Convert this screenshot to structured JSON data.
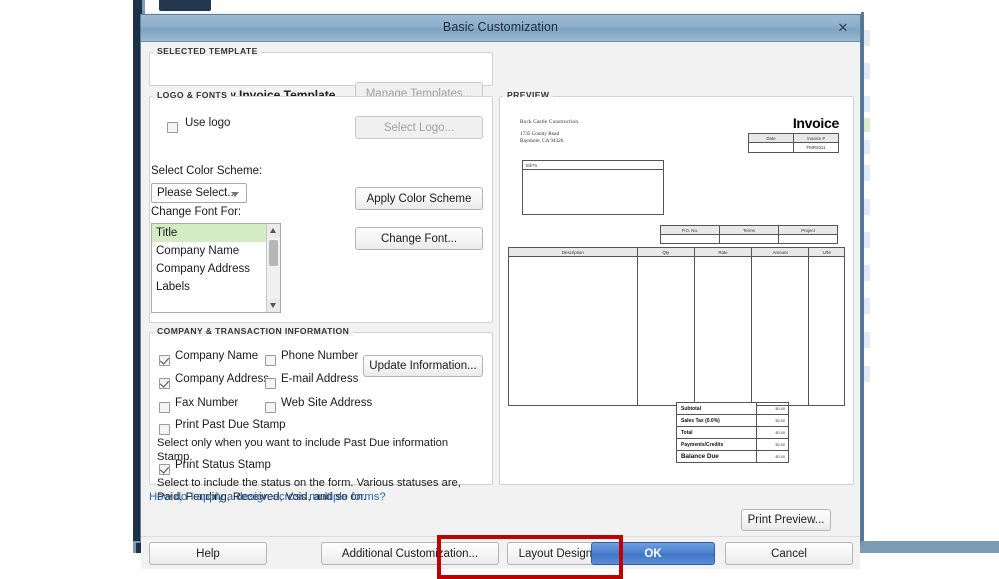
{
  "window": {
    "title": "Basic Customization",
    "close_icon": "close-icon"
  },
  "selected_template": {
    "legend": "SELECTED TEMPLATE",
    "name": "Copy of: New Invoice Template",
    "manage_button": "Manage Templates..."
  },
  "logo_fonts": {
    "legend": "LOGO & FONTS",
    "use_logo_label": "Use logo",
    "use_logo_checked": false,
    "select_logo_button": "Select Logo...",
    "color_scheme_label": "Select Color Scheme:",
    "color_scheme_value": "Please Select..",
    "apply_color_button": "Apply Color Scheme",
    "change_font_label": "Change Font For:",
    "change_font_button": "Change Font...",
    "font_list": [
      {
        "label": "Title",
        "selected": true
      },
      {
        "label": "Company Name",
        "selected": false
      },
      {
        "label": "Company Address",
        "selected": false
      },
      {
        "label": "Labels",
        "selected": false
      }
    ]
  },
  "company_info": {
    "legend": "COMPANY & TRANSACTION INFORMATION",
    "checkboxes": [
      {
        "label": "Company Name",
        "checked": true
      },
      {
        "label": "Phone Number",
        "checked": false
      },
      {
        "label": "Company Address",
        "checked": true
      },
      {
        "label": "E-mail Address",
        "checked": false
      },
      {
        "label": "Fax Number",
        "checked": false
      },
      {
        "label": "Web Site Address",
        "checked": false
      }
    ],
    "update_button": "Update Information...",
    "past_due_label": "Print Past Due Stamp",
    "past_due_checked": false,
    "past_due_help": "Select only when you want to include Past Due information Stamp.",
    "status_stamp_label": "Print Status Stamp",
    "status_stamp_checked": true,
    "status_stamp_help": "Select to include the status on the form. Various statuses are, Paid, Pending, Received, Void, and so on."
  },
  "help_link": "How do I apply a design across multiple forms?",
  "preview": {
    "legend": "PREVIEW",
    "print_preview_button": "Print Preview..."
  },
  "footer": {
    "help": "Help",
    "additional_customization": "Additional Customization...",
    "layout_designer": "Layout Designer...",
    "ok": "OK",
    "cancel": "Cancel"
  },
  "highlight_color": "#c00000",
  "accent_color": "#4a7fd0",
  "invoice": {
    "company_name": "Rock Castle Construction",
    "address_line1": "1735 County Road",
    "address_line2": "Bayshore, CA 94326",
    "title": "Invoice",
    "date_header": "Date",
    "invoice_no_header": "Invoice #",
    "date_value": "",
    "invoice_no_value": "FMR2011",
    "bill_to_label": "Bill To",
    "terms_headers": [
      "P.O. No.",
      "Terms",
      "Project"
    ],
    "item_headers": [
      "Description",
      "Qty",
      "Rate",
      "Amount",
      "U/M"
    ],
    "totals": [
      {
        "label": "Subtotal",
        "amount": "$0.00",
        "emphasis": false
      },
      {
        "label": "Sales Tax  (0.0%)",
        "amount": "$0.00",
        "emphasis": false
      },
      {
        "label": "Total",
        "amount": "$0.00",
        "emphasis": false
      },
      {
        "label": "Payments/Credits",
        "amount": "$0.00",
        "emphasis": false
      },
      {
        "label": "Balance Due",
        "amount": "$0.00",
        "emphasis": true
      }
    ]
  }
}
